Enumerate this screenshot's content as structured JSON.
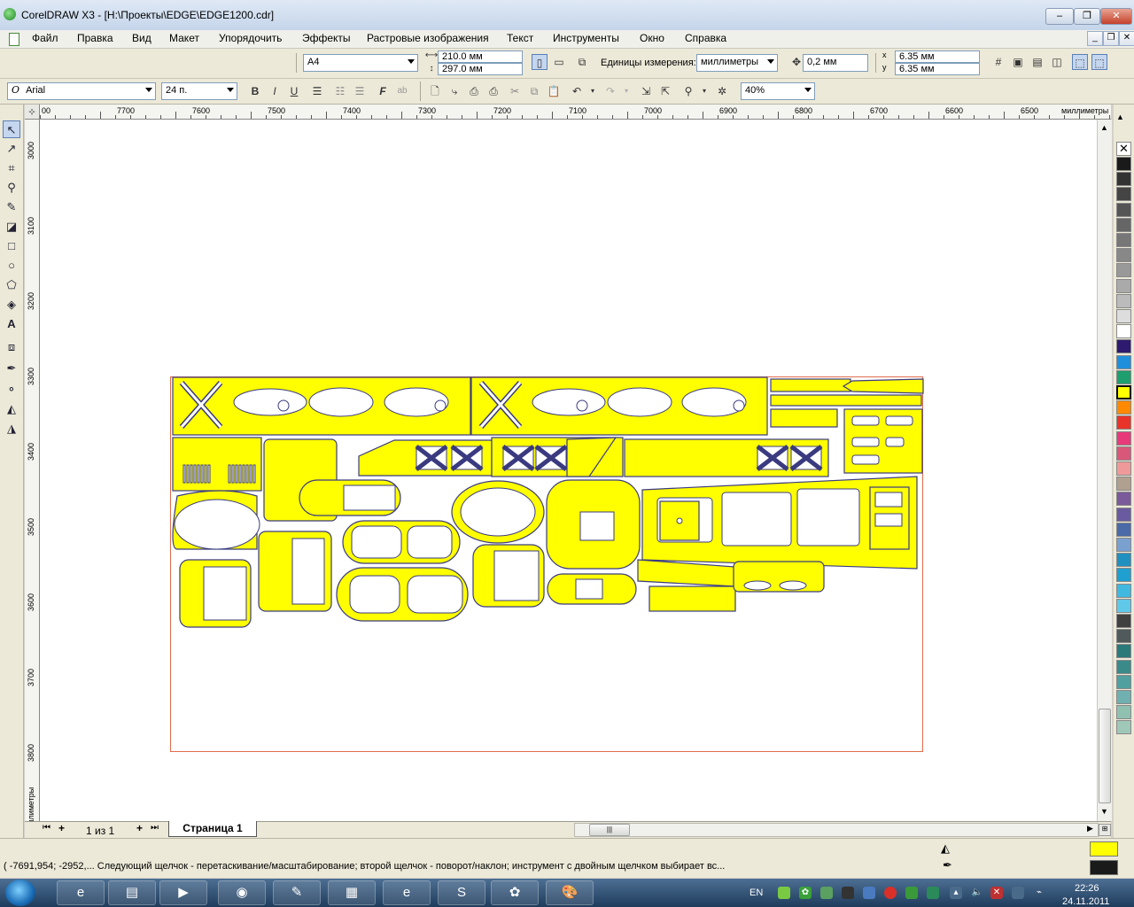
{
  "window": {
    "title": "CorelDRAW X3 - [H:\\Проекты\\EDGE\\EDGE1200.cdr]",
    "controls": {
      "minimize": "–",
      "maximize": "❐",
      "close": "✕"
    }
  },
  "menu": {
    "items": [
      "Файл",
      "Правка",
      "Вид",
      "Макет",
      "Упорядочить",
      "Эффекты",
      "Растровые изображения",
      "Текст",
      "Инструменты",
      "Окно",
      "Справка"
    ]
  },
  "property_bar": {
    "paper_size": "A4",
    "width": "210.0 мм",
    "height": "297.0 мм",
    "units_label": "Единицы измерения:",
    "units_value": "миллиметры",
    "nudge": "0,2 мм",
    "dup_x": "6.35 мм",
    "dup_y": "6.35 мм"
  },
  "text_bar": {
    "font_name": "Arial",
    "font_size": "24 п.",
    "zoom": "40%"
  },
  "rulers": {
    "top_labels": [
      "00",
      "7700",
      "7600",
      "7500",
      "7400",
      "7300",
      "7200",
      "7100",
      "7000",
      "6900",
      "6800",
      "6700",
      "6600",
      "6500"
    ],
    "top_unit": "миллиметры",
    "left_labels": [
      "3000",
      "3100",
      "3200",
      "3300",
      "3400",
      "3500",
      "3600",
      "3700",
      "3800"
    ],
    "left_unit": "миллиметры"
  },
  "page_tabs": {
    "counter": "1 из 1",
    "active_tab": "Страница 1"
  },
  "status": {
    "text": "( -7691,954; -2952,...  Следующий щелчок - перетаскивание/масштабирование; второй щелчок - поворот/наклон; инструмент с двойным щелчком выбирает вс..."
  },
  "colors": {
    "fill": "#ffff00",
    "outline": "#1a1a1a",
    "parts_fill": "#ffff00",
    "parts_stroke": "#3a3a80",
    "page_border": "#e06c4c"
  },
  "palette": [
    "#1a1a1a",
    "#333333",
    "#444444",
    "#555555",
    "#666666",
    "#777777",
    "#888888",
    "#999999",
    "#aaaaaa",
    "#bbbbbb",
    "#dddddd",
    "#ffffff",
    "#2e1a6e",
    "#1f8fdc",
    "#1f9e6e",
    "#ffff00",
    "#ff8a00",
    "#e8332a",
    "#e83a7a",
    "#d9587a",
    "#ee9a9a",
    "#b0a090",
    "#7a5a9a",
    "#6a5aa0",
    "#4a6aa8",
    "#7aa0d0",
    "#2090c0",
    "#20a0d0",
    "#40b8e0",
    "#60c8e8",
    "#404040",
    "#505a5a",
    "#2a7a7a",
    "#3a8a8a",
    "#50a0a0",
    "#70b0b0",
    "#90c0b0",
    "#a0c8b8"
  ],
  "taskbar": {
    "lang": "EN",
    "time": "22:26",
    "date": "24.11.2011"
  }
}
